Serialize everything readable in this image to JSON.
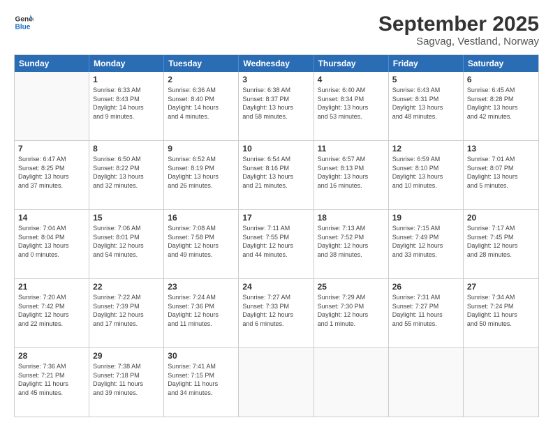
{
  "logo": {
    "line1": "General",
    "line2": "Blue"
  },
  "title": "September 2025",
  "subtitle": "Sagvag, Vestland, Norway",
  "header_days": [
    "Sunday",
    "Monday",
    "Tuesday",
    "Wednesday",
    "Thursday",
    "Friday",
    "Saturday"
  ],
  "weeks": [
    [
      {
        "day": "",
        "empty": true
      },
      {
        "day": "1",
        "sunrise": "Sunrise: 6:33 AM",
        "sunset": "Sunset: 8:43 PM",
        "daylight": "Daylight: 14 hours and 9 minutes."
      },
      {
        "day": "2",
        "sunrise": "Sunrise: 6:36 AM",
        "sunset": "Sunset: 8:40 PM",
        "daylight": "Daylight: 14 hours and 4 minutes."
      },
      {
        "day": "3",
        "sunrise": "Sunrise: 6:38 AM",
        "sunset": "Sunset: 8:37 PM",
        "daylight": "Daylight: 13 hours and 58 minutes."
      },
      {
        "day": "4",
        "sunrise": "Sunrise: 6:40 AM",
        "sunset": "Sunset: 8:34 PM",
        "daylight": "Daylight: 13 hours and 53 minutes."
      },
      {
        "day": "5",
        "sunrise": "Sunrise: 6:43 AM",
        "sunset": "Sunset: 8:31 PM",
        "daylight": "Daylight: 13 hours and 48 minutes."
      },
      {
        "day": "6",
        "sunrise": "Sunrise: 6:45 AM",
        "sunset": "Sunset: 8:28 PM",
        "daylight": "Daylight: 13 hours and 42 minutes."
      }
    ],
    [
      {
        "day": "7",
        "sunrise": "Sunrise: 6:47 AM",
        "sunset": "Sunset: 8:25 PM",
        "daylight": "Daylight: 13 hours and 37 minutes."
      },
      {
        "day": "8",
        "sunrise": "Sunrise: 6:50 AM",
        "sunset": "Sunset: 8:22 PM",
        "daylight": "Daylight: 13 hours and 32 minutes."
      },
      {
        "day": "9",
        "sunrise": "Sunrise: 6:52 AM",
        "sunset": "Sunset: 8:19 PM",
        "daylight": "Daylight: 13 hours and 26 minutes."
      },
      {
        "day": "10",
        "sunrise": "Sunrise: 6:54 AM",
        "sunset": "Sunset: 8:16 PM",
        "daylight": "Daylight: 13 hours and 21 minutes."
      },
      {
        "day": "11",
        "sunrise": "Sunrise: 6:57 AM",
        "sunset": "Sunset: 8:13 PM",
        "daylight": "Daylight: 13 hours and 16 minutes."
      },
      {
        "day": "12",
        "sunrise": "Sunrise: 6:59 AM",
        "sunset": "Sunset: 8:10 PM",
        "daylight": "Daylight: 13 hours and 10 minutes."
      },
      {
        "day": "13",
        "sunrise": "Sunrise: 7:01 AM",
        "sunset": "Sunset: 8:07 PM",
        "daylight": "Daylight: 13 hours and 5 minutes."
      }
    ],
    [
      {
        "day": "14",
        "sunrise": "Sunrise: 7:04 AM",
        "sunset": "Sunset: 8:04 PM",
        "daylight": "Daylight: 13 hours and 0 minutes."
      },
      {
        "day": "15",
        "sunrise": "Sunrise: 7:06 AM",
        "sunset": "Sunset: 8:01 PM",
        "daylight": "Daylight: 12 hours and 54 minutes."
      },
      {
        "day": "16",
        "sunrise": "Sunrise: 7:08 AM",
        "sunset": "Sunset: 7:58 PM",
        "daylight": "Daylight: 12 hours and 49 minutes."
      },
      {
        "day": "17",
        "sunrise": "Sunrise: 7:11 AM",
        "sunset": "Sunset: 7:55 PM",
        "daylight": "Daylight: 12 hours and 44 minutes."
      },
      {
        "day": "18",
        "sunrise": "Sunrise: 7:13 AM",
        "sunset": "Sunset: 7:52 PM",
        "daylight": "Daylight: 12 hours and 38 minutes."
      },
      {
        "day": "19",
        "sunrise": "Sunrise: 7:15 AM",
        "sunset": "Sunset: 7:49 PM",
        "daylight": "Daylight: 12 hours and 33 minutes."
      },
      {
        "day": "20",
        "sunrise": "Sunrise: 7:17 AM",
        "sunset": "Sunset: 7:45 PM",
        "daylight": "Daylight: 12 hours and 28 minutes."
      }
    ],
    [
      {
        "day": "21",
        "sunrise": "Sunrise: 7:20 AM",
        "sunset": "Sunset: 7:42 PM",
        "daylight": "Daylight: 12 hours and 22 minutes."
      },
      {
        "day": "22",
        "sunrise": "Sunrise: 7:22 AM",
        "sunset": "Sunset: 7:39 PM",
        "daylight": "Daylight: 12 hours and 17 minutes."
      },
      {
        "day": "23",
        "sunrise": "Sunrise: 7:24 AM",
        "sunset": "Sunset: 7:36 PM",
        "daylight": "Daylight: 12 hours and 11 minutes."
      },
      {
        "day": "24",
        "sunrise": "Sunrise: 7:27 AM",
        "sunset": "Sunset: 7:33 PM",
        "daylight": "Daylight: 12 hours and 6 minutes."
      },
      {
        "day": "25",
        "sunrise": "Sunrise: 7:29 AM",
        "sunset": "Sunset: 7:30 PM",
        "daylight": "Daylight: 12 hours and 1 minute."
      },
      {
        "day": "26",
        "sunrise": "Sunrise: 7:31 AM",
        "sunset": "Sunset: 7:27 PM",
        "daylight": "Daylight: 11 hours and 55 minutes."
      },
      {
        "day": "27",
        "sunrise": "Sunrise: 7:34 AM",
        "sunset": "Sunset: 7:24 PM",
        "daylight": "Daylight: 11 hours and 50 minutes."
      }
    ],
    [
      {
        "day": "28",
        "sunrise": "Sunrise: 7:36 AM",
        "sunset": "Sunset: 7:21 PM",
        "daylight": "Daylight: 11 hours and 45 minutes."
      },
      {
        "day": "29",
        "sunrise": "Sunrise: 7:38 AM",
        "sunset": "Sunset: 7:18 PM",
        "daylight": "Daylight: 11 hours and 39 minutes."
      },
      {
        "day": "30",
        "sunrise": "Sunrise: 7:41 AM",
        "sunset": "Sunset: 7:15 PM",
        "daylight": "Daylight: 11 hours and 34 minutes."
      },
      {
        "day": "",
        "empty": true
      },
      {
        "day": "",
        "empty": true
      },
      {
        "day": "",
        "empty": true
      },
      {
        "day": "",
        "empty": true
      }
    ]
  ]
}
